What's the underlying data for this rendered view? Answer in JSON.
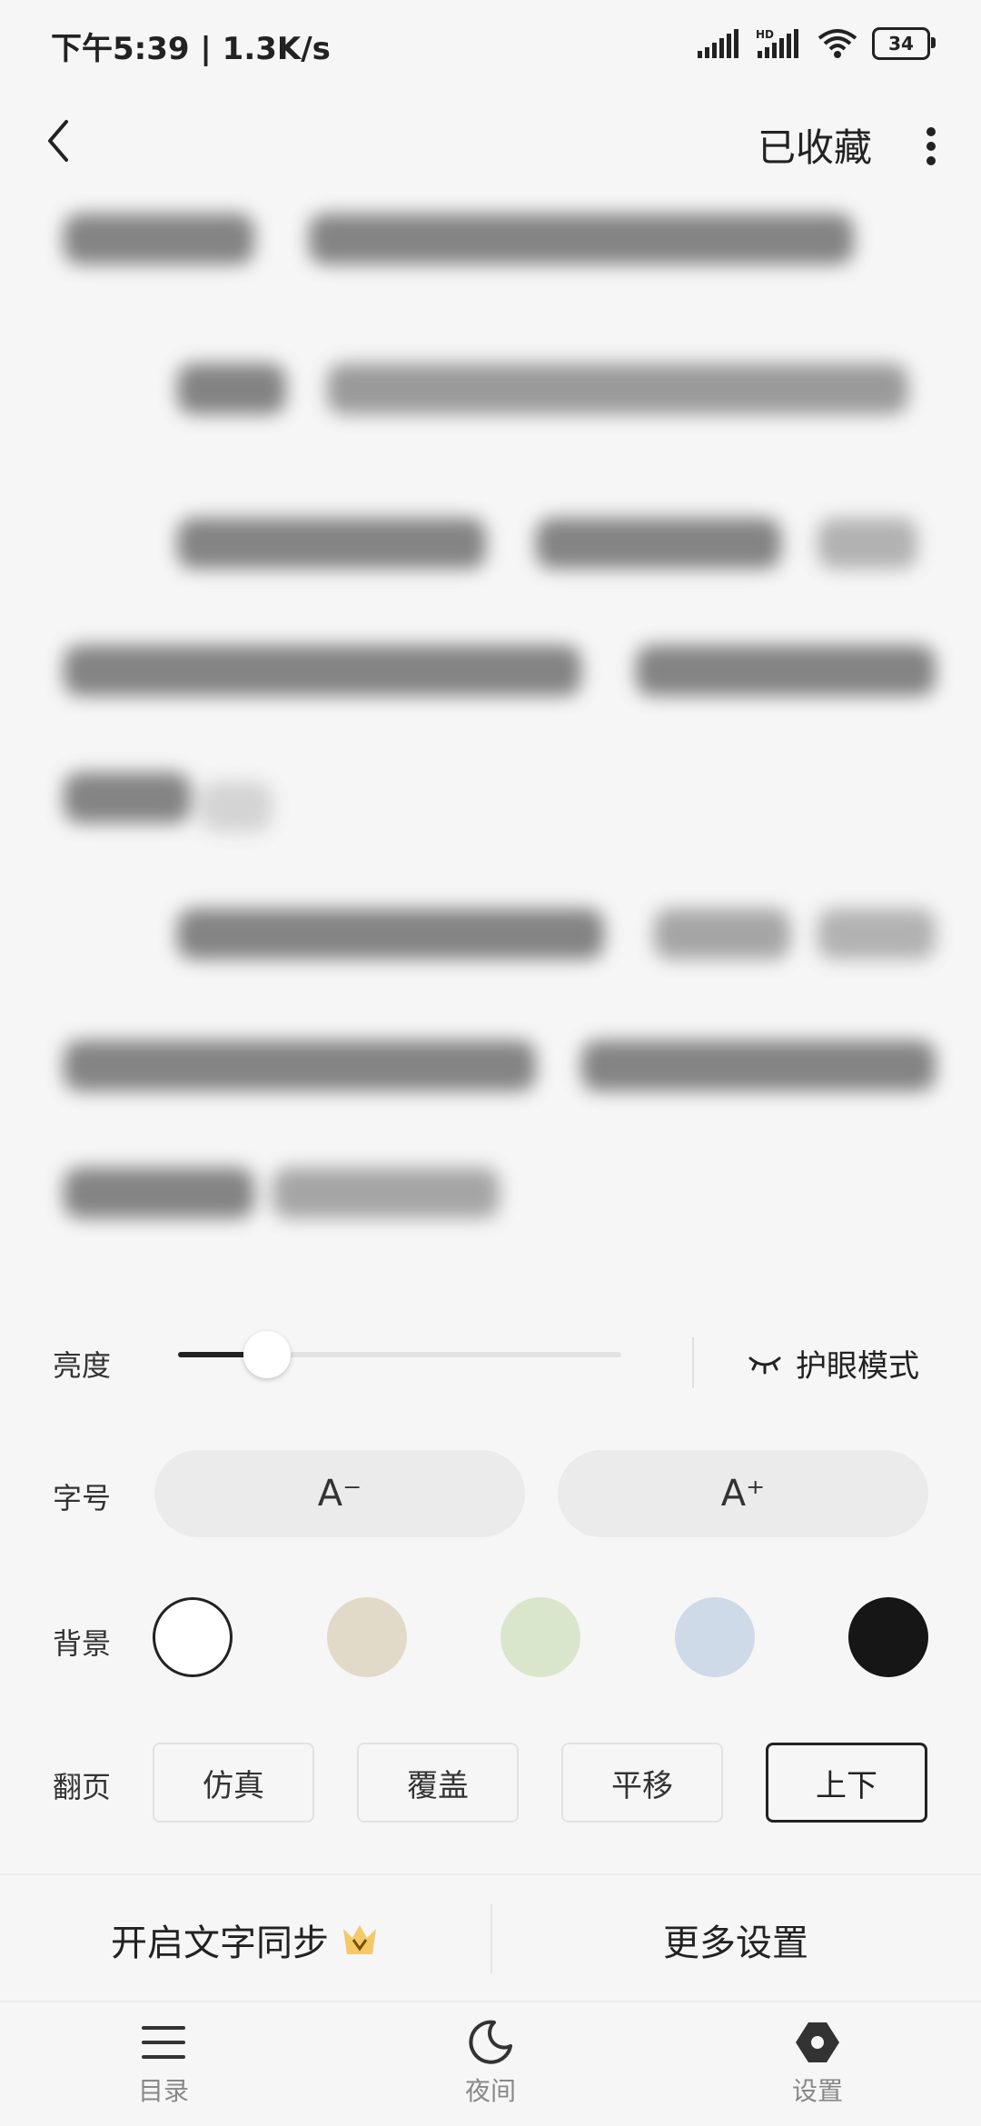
{
  "status": {
    "time_speed": "下午5:39 | 1.3K/s",
    "battery": "34"
  },
  "topbar": {
    "collected_label": "已收藏"
  },
  "settings": {
    "brightness_label": "亮度",
    "brightness_level": 0.2,
    "eye_mode_label": "护眼模式",
    "font_label": "字号",
    "font_decrease": "A⁻",
    "font_increase": "A⁺",
    "background_label": "背景",
    "background_colors": [
      "#ffffff",
      "#e2dac8",
      "#d9e6cc",
      "#cfdae8",
      "#161616"
    ],
    "page_label": "翻页",
    "page_modes": [
      "仿真",
      "覆盖",
      "平移",
      "上下"
    ],
    "page_selected": "上下"
  },
  "bottom_options": {
    "sync_text": "开启文字同步",
    "more_settings": "更多设置"
  },
  "nav": {
    "toc": "目录",
    "night": "夜间",
    "settings": "设置"
  }
}
